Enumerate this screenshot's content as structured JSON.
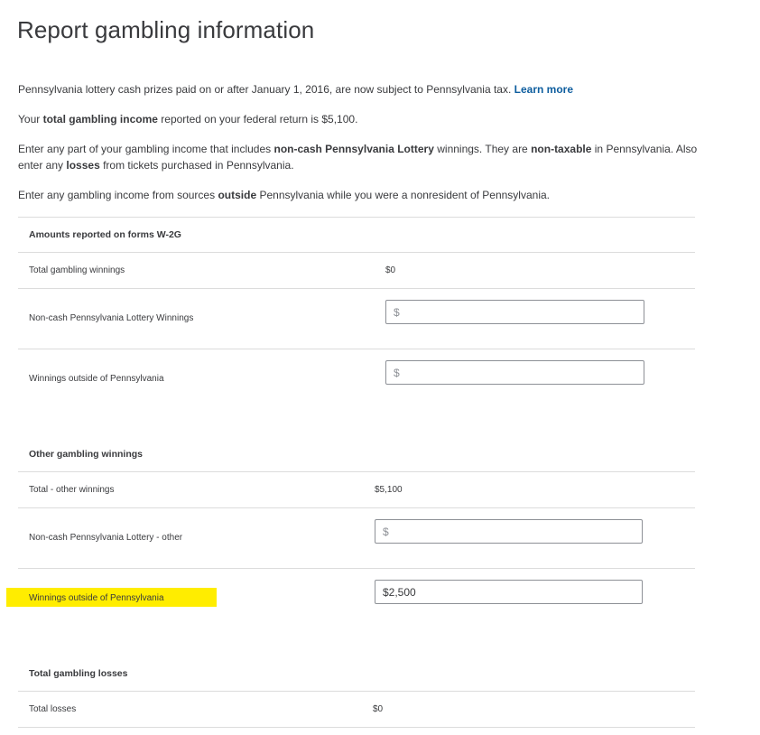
{
  "page": {
    "title": "Report gambling information"
  },
  "intro": {
    "p1_text": "Pennsylvania lottery cash prizes paid on or after January 1, 2016, are now subject to Pennsylvania tax.",
    "p1_link": "Learn more",
    "p2_before": "Your",
    "p2_bold": "total gambling income",
    "p2_after": "reported on your federal return is $5,100.",
    "p3_a": "Enter any part of your gambling income that includes",
    "p3_b": "non-cash Pennsylvania Lottery",
    "p3_c": "winnings. They are",
    "p3_d": "non-taxable",
    "p3_e": "in Pennsylvania. Also enter any",
    "p3_f": "losses",
    "p3_g": "from tickets purchased in Pennsylvania.",
    "p4_a": "Enter any gambling income from sources",
    "p4_b": "outside",
    "p4_c": "Pennsylvania while you were a nonresident of Pennsylvania."
  },
  "w2g": {
    "title": "Amounts reported on forms W-2G",
    "total_label": "Total gambling winnings",
    "total_value": "$0",
    "noncash_label": "Non-cash Pennsylvania Lottery Winnings",
    "noncash_placeholder": "$",
    "outside_label": "Winnings outside of Pennsylvania",
    "outside_placeholder": "$"
  },
  "other": {
    "title": "Other gambling winnings",
    "total_label": "Total - other winnings",
    "total_value": "$5,100",
    "noncash_label": "Non-cash Pennsylvania Lottery - other",
    "noncash_placeholder": "$",
    "outside_label": "Winnings outside of Pennsylvania",
    "outside_value": "$2,500"
  },
  "losses": {
    "title": "Total gambling losses",
    "total_label": "Total losses",
    "total_value": "$0"
  },
  "colors": {
    "highlight": "#ffed00",
    "link": "#0d5d9e",
    "text": "#393a3d",
    "divider": "#dcdcdc"
  }
}
